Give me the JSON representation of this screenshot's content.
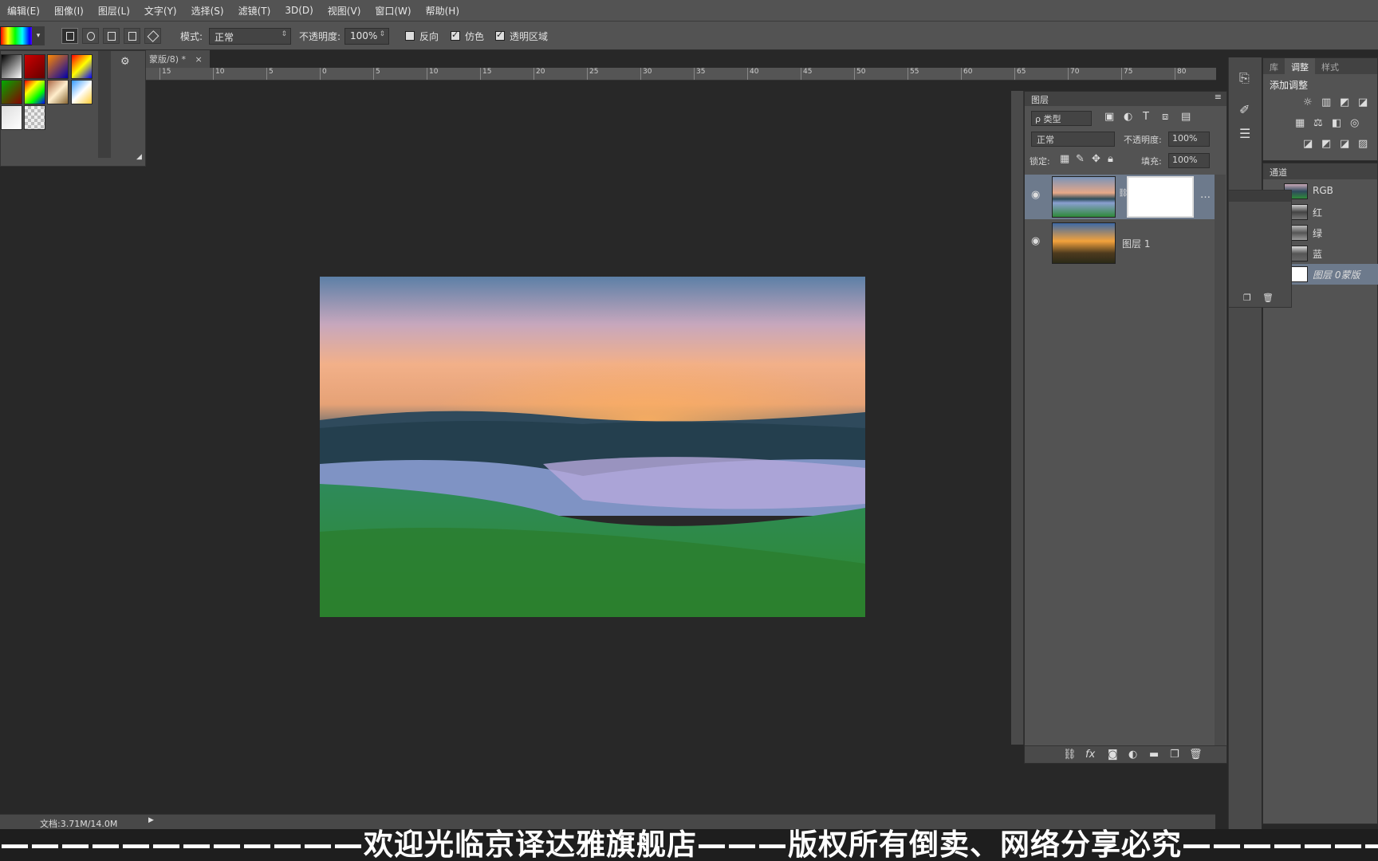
{
  "menu": {
    "items": [
      "编辑(E)",
      "图像(I)",
      "图层(L)",
      "文字(Y)",
      "选择(S)",
      "滤镜(T)",
      "3D(D)",
      "视图(V)",
      "窗口(W)",
      "帮助(H)"
    ]
  },
  "options": {
    "mode_label": "模式:",
    "mode_value": "正常",
    "opacity_label": "不透明度:",
    "opacity_value": "100%",
    "reverse_label": "反向",
    "dither_label": "仿色",
    "transparency_label": "透明区域",
    "reverse_checked": false,
    "dither_checked": true,
    "transparency_checked": true
  },
  "document": {
    "tab_title": "蒙版/8) *",
    "ruler_ticks": [
      "15",
      "10",
      "5",
      "0",
      "5",
      "10",
      "15",
      "20",
      "25",
      "30",
      "35",
      "40",
      "45",
      "50",
      "55",
      "60",
      "65",
      "70",
      "75",
      "80"
    ]
  },
  "layers_panel": {
    "title": "图层",
    "filter_label": "ρ 类型",
    "blend_mode": "正常",
    "opacity_label": "不透明度:",
    "opacity_value": "100%",
    "lock_label": "锁定:",
    "fill_label": "填充:",
    "fill_value": "100%",
    "layers": [
      {
        "name": "",
        "has_mask": true,
        "selected": true
      },
      {
        "name": "图层 1",
        "has_mask": false,
        "selected": false
      }
    ]
  },
  "adjustments_panel": {
    "tabs": [
      "库",
      "调整",
      "样式"
    ],
    "active_tab": "调整",
    "heading": "添加调整"
  },
  "channels_panel": {
    "title": "通道",
    "channels": [
      "RGB",
      "红",
      "绿",
      "蓝",
      "图层 0蒙版"
    ]
  },
  "status": {
    "doc_size": "文档:3.71M/14.0M"
  },
  "watermark": {
    "text": "————————————欢迎光临京译达雅旗舰店———版权所有倒卖、网络分享必究————————————"
  },
  "colors": {
    "ui_bg": "#535353",
    "canvas_bg": "#282828",
    "selected_row": "#6d7a8c"
  }
}
